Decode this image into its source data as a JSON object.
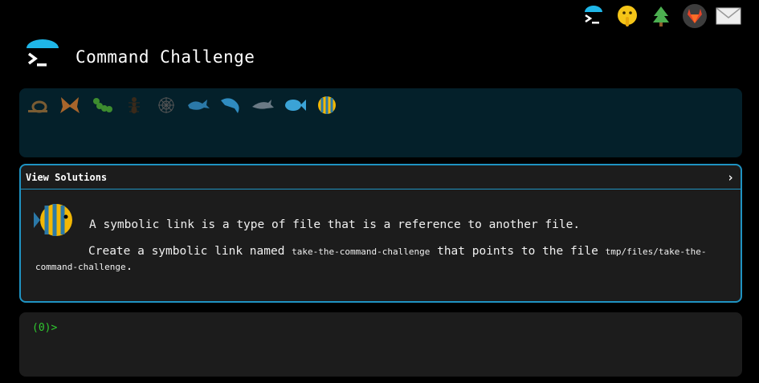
{
  "header": {
    "title": "Command Challenge"
  },
  "top_icons": [
    "terminal-logo-icon",
    "shushing-face-icon",
    "evergreen-tree-icon",
    "gitlab-icon",
    "envelope-icon"
  ],
  "critters": [
    "snail",
    "butterfly",
    "caterpillar",
    "ant",
    "spider-web",
    "whale",
    "dolphin",
    "dolphin-gray",
    "fish-blue",
    "tropical-fish"
  ],
  "solutions": {
    "label": "View Solutions",
    "chevron": "›"
  },
  "challenge": {
    "description": "A symbolic link is a type of file that is a reference to another file.",
    "task_pre": "Create a symbolic link named ",
    "link_name": "take-the-command-challenge",
    "task_mid": " that points to the file ",
    "target": "tmp/files/take-the-command-challenge",
    "task_end": "."
  },
  "terminal": {
    "prompt": "(0)>"
  },
  "colors": {
    "accent": "#1f93c2",
    "prompt": "#2fc82f",
    "critter_bg": "#04202a"
  }
}
